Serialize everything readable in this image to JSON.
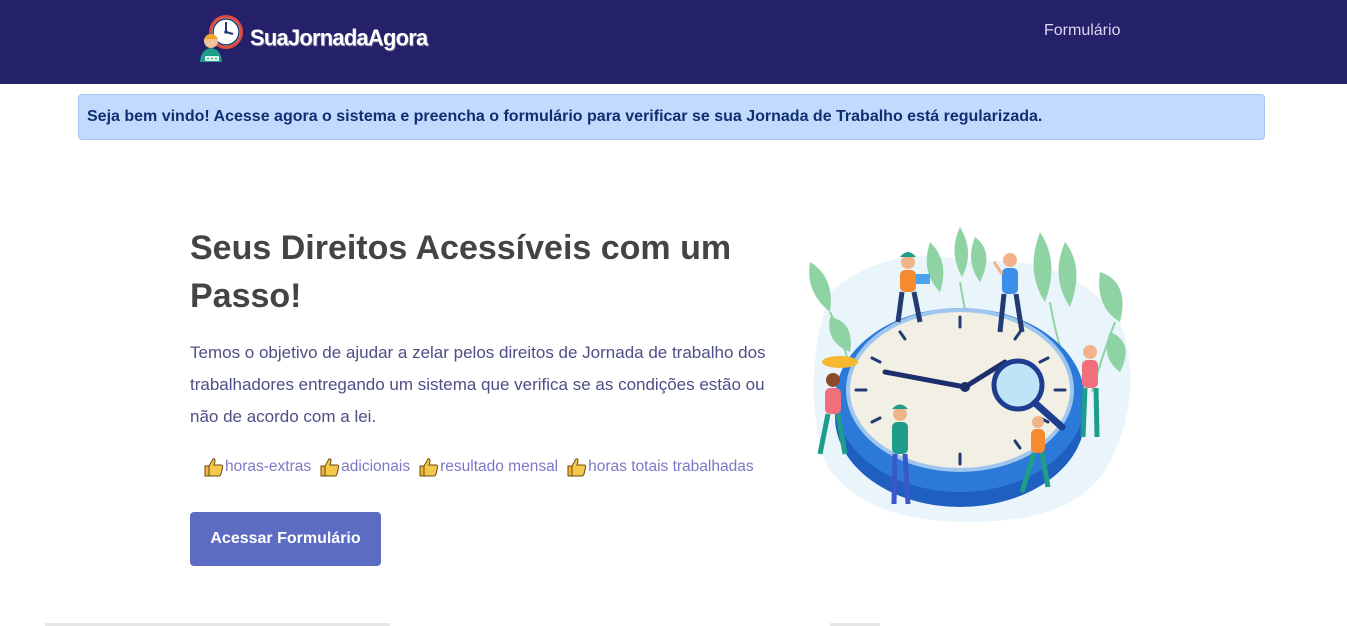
{
  "navbar": {
    "brand_name": "SuaJornadaAgora",
    "nav_link": "Formulário",
    "colors": {
      "background": "#25206a",
      "link": "#d8d8ef"
    }
  },
  "alert": {
    "message": "Seja bem vindo! Acesse agora o sistema e preencha o formulário para verificar se sua Jornada de Trabalho está regularizada.",
    "colors": {
      "background": "#c2dafd",
      "text": "#0e2f70"
    }
  },
  "hero": {
    "title": "Seus Direitos Acessíveis com um Passo!",
    "description": "Temos o objetivo de ajudar a zelar pelos direitos de Jornada de trabalho dos trabalhadores entregando um sistema que verifica se as condições estão ou não de acordo com a lei.",
    "tags": [
      {
        "icon": "thumbs-up-icon",
        "label": "horas-extras"
      },
      {
        "icon": "thumbs-up-icon",
        "label": "adicionais"
      },
      {
        "icon": "thumbs-up-icon",
        "label": "resultado mensal"
      },
      {
        "icon": "thumbs-up-icon",
        "label": "horas totais trabalhadas"
      }
    ],
    "cta_label": "Acessar Formulário",
    "colors": {
      "title": "#444444",
      "description": "#4d4f86",
      "tag": "#7c78c6",
      "button": "#5c6cc2"
    }
  },
  "illustration": {
    "icon": "clock-team-illustration"
  }
}
